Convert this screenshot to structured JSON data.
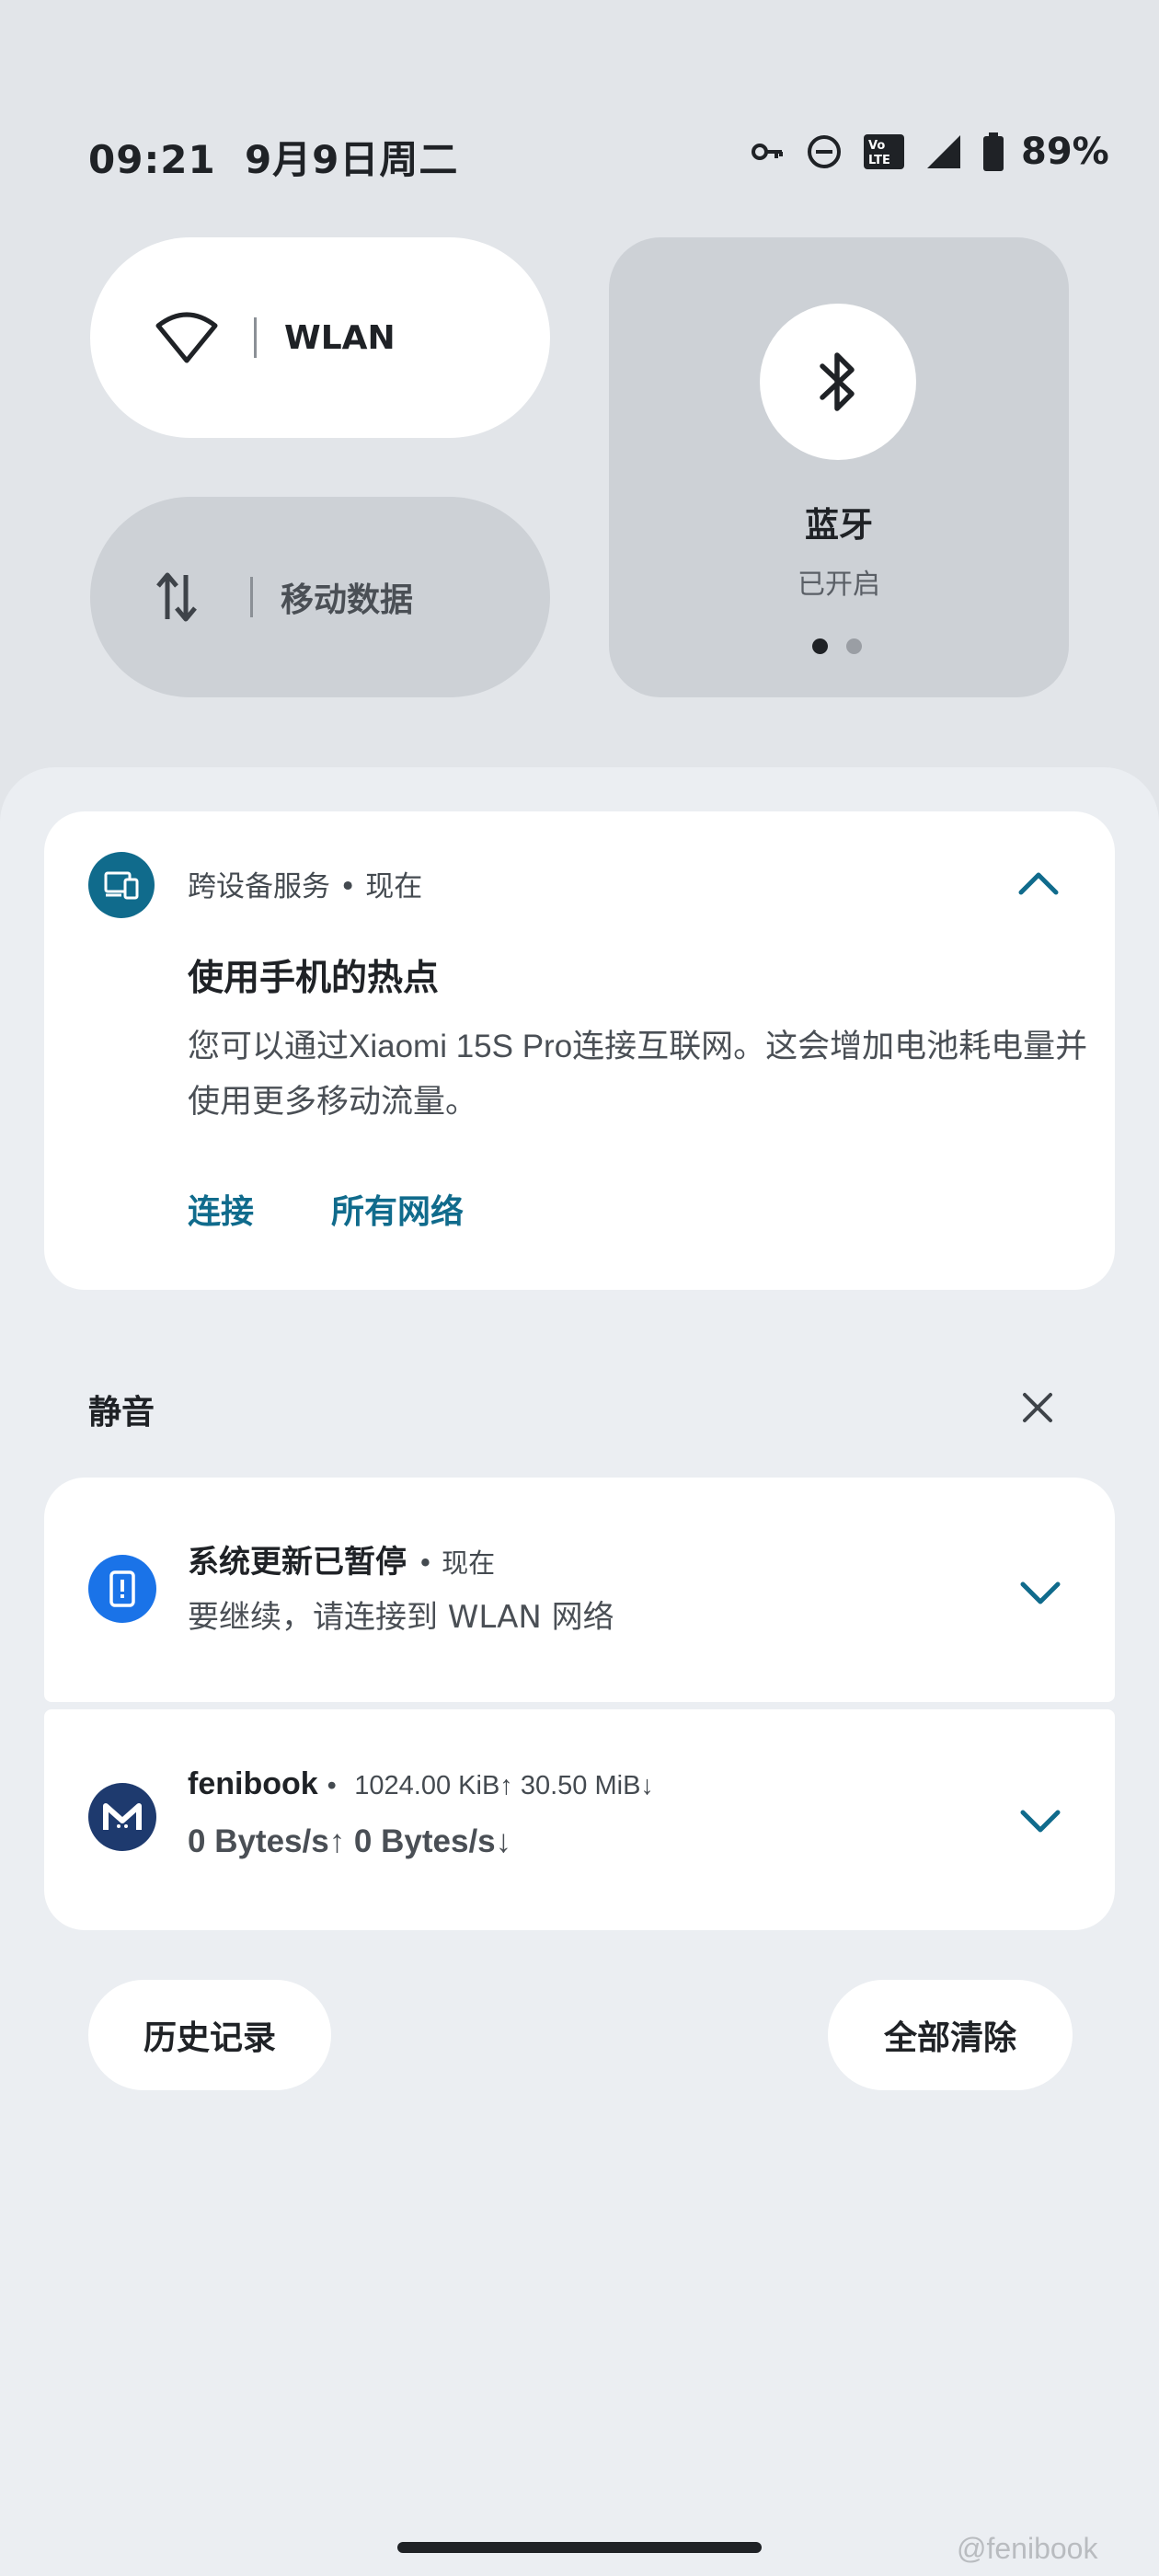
{
  "status_bar": {
    "time": "09:21",
    "date": "9月9日周二",
    "battery": "89%",
    "icons": [
      "vpn-key-icon",
      "do-not-disturb-icon",
      "volte-icon",
      "signal-icon",
      "battery-icon"
    ]
  },
  "quick_tiles": {
    "wlan": {
      "label": "WLAN",
      "icon": "wifi-icon",
      "active": true
    },
    "mobile_data": {
      "label": "移动数据",
      "icon": "mobile-data-icon",
      "active": false
    },
    "bluetooth": {
      "label": "蓝牙",
      "status": "已开启",
      "icon": "bluetooth-icon",
      "page_dots": 2,
      "current_page": 1
    }
  },
  "notifications": {
    "hotspot": {
      "app": "跨设备服务",
      "time": "现在",
      "title": "使用手机的热点",
      "body": "您可以通过Xiaomi 15S Pro连接互联网。这会增加电池耗电量并使用更多移动流量。",
      "actions": [
        "连接",
        "所有网络"
      ],
      "icon_color": "#106b8c"
    },
    "silent_section": {
      "title": "静音"
    },
    "system_update": {
      "title": "系统更新已暂停",
      "time": "现在",
      "body": "要继续，请连接到 WLAN 网络",
      "icon_color": "#1a73e8"
    },
    "fenibook": {
      "title": "fenibook",
      "meta": "1024.00 KiB↑  30.50 MiB↓",
      "body": "0 Bytes/s↑  0 Bytes/s↓",
      "icon_color": "#1e3a6e"
    }
  },
  "buttons": {
    "history": "历史记录",
    "clear_all": "全部清除"
  },
  "watermark": "@fenibook",
  "colors": {
    "accent": "#106b8c",
    "background": "#e2e5e9",
    "shade": "#ebeef2"
  }
}
